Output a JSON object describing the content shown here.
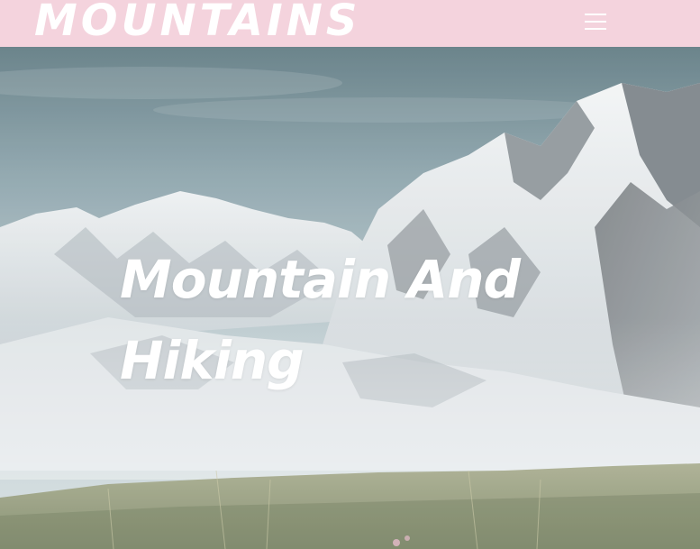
{
  "header": {
    "logo_text": "MOUNTAINS",
    "menu_icon": "hamburger-menu-icon",
    "background": "#f4d3dd"
  },
  "hero": {
    "title": "Mountain And Hiking",
    "background_image": "snowy-mountain-landscape"
  }
}
